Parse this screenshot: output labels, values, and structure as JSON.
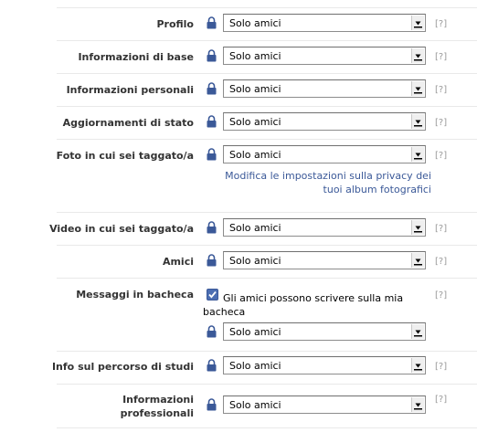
{
  "help_link_label": "[?]",
  "rows": [
    {
      "label": "Profilo",
      "audience": "Solo amici"
    },
    {
      "label": "Informazioni di base",
      "audience": "Solo amici"
    },
    {
      "label": "Informazioni personali",
      "audience": "Solo amici"
    },
    {
      "label": "Aggiornamenti di stato",
      "audience": "Solo amici"
    },
    {
      "label": "Foto in cui sei taggato/a",
      "audience": "Solo amici",
      "link": "Modifica le impostazioni sulla privacy dei tuoi album fotografici"
    },
    {
      "label": "Video in cui sei taggato/a",
      "audience": "Solo amici"
    },
    {
      "label": "Amici",
      "audience": "Solo amici"
    },
    {
      "label": "Messaggi in bacheca",
      "audience": "Solo amici",
      "checkbox_label": "Gli amici possono scrivere sulla mia bacheca",
      "checkbox_checked": true
    },
    {
      "label": "Info sul percorso di studi",
      "audience": "Solo amici"
    },
    {
      "label": "Informazioni professionali",
      "audience": "Solo amici"
    }
  ],
  "colors": {
    "link": "#3b5998",
    "lock": "#3b5998",
    "label": "#333333",
    "help": "#9a9a9a"
  },
  "icons": {
    "privacy": "lock-icon",
    "dropdown": "chevron-down-icon",
    "checkbox": "checkmark-icon"
  }
}
